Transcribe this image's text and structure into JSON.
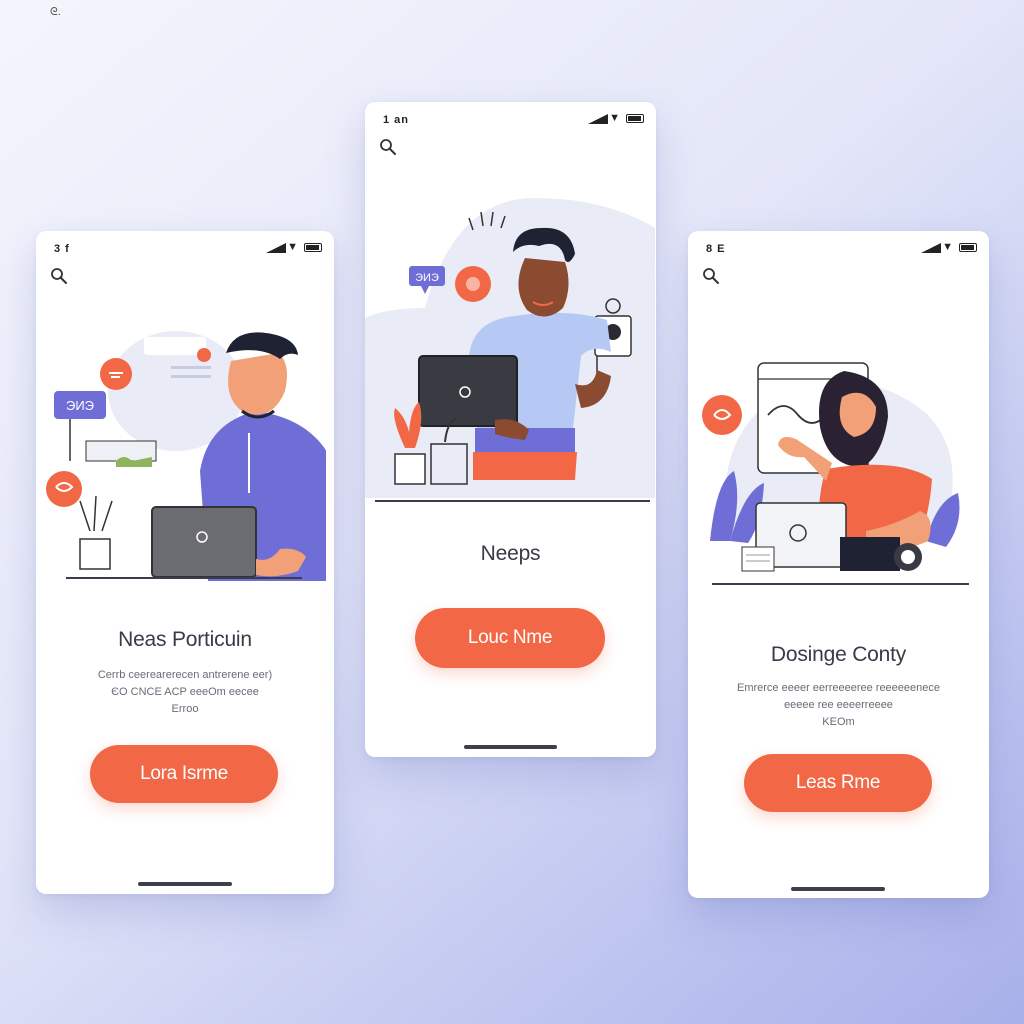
{
  "corner_mark": "ᘓ.",
  "phones": [
    {
      "id": "left",
      "status": {
        "time": "3 f",
        "wifi_icon": "wifi-icon",
        "signal_icon": "signal-icon",
        "battery_icon": "battery-icon"
      },
      "search_icon": "search-icon",
      "badge_text": "ЭИЭ",
      "title": "Neas Porticuin",
      "description_lines": [
        "Cerrb ceerearerecen antrerene eer)",
        "ЄO CNCE ACP eeeOm eecee",
        "Erroo"
      ],
      "cta_label": "Lora Isrme"
    },
    {
      "id": "middle",
      "status": {
        "time": "1 an",
        "wifi_icon": "wifi-icon",
        "signal_icon": "signal-icon",
        "battery_icon": "battery-icon"
      },
      "search_icon": "search-icon",
      "badge_text": "ЭИЭ",
      "title": "Neeps",
      "cta_label": "Louc Nme"
    },
    {
      "id": "right",
      "status": {
        "time": "8 E",
        "wifi_icon": "wifi-icon",
        "signal_icon": "signal-icon",
        "battery_icon": "battery-icon"
      },
      "search_icon": "search-icon",
      "title": "Dosinge Conty",
      "description_lines": [
        "Emrerce eeeer eerreeeeree reeeeeenece",
        "eeeee ree eeeerreeee",
        "KEOm"
      ],
      "cta_label": "Leas Rme"
    }
  ],
  "colors": {
    "accent": "#f26846",
    "purple": "#6f6ed6",
    "blue_shirt": "#b6c8f4",
    "background_start": "#f4f5fc",
    "background_end": "#a8b0ea",
    "text_dark": "#3a3a48"
  }
}
